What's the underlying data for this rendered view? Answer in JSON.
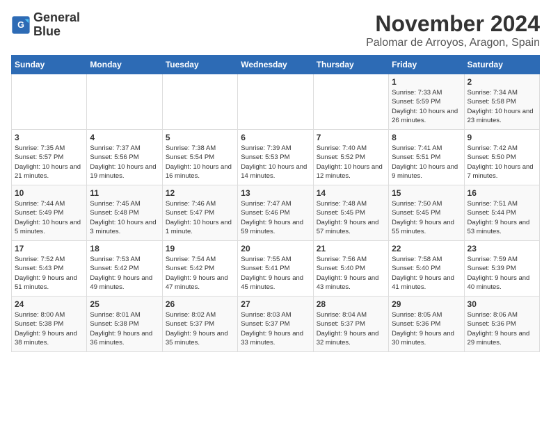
{
  "logo": {
    "line1": "General",
    "line2": "Blue"
  },
  "title": "November 2024",
  "location": "Palomar de Arroyos, Aragon, Spain",
  "days_of_week": [
    "Sunday",
    "Monday",
    "Tuesday",
    "Wednesday",
    "Thursday",
    "Friday",
    "Saturday"
  ],
  "weeks": [
    [
      {
        "day": "",
        "info": ""
      },
      {
        "day": "",
        "info": ""
      },
      {
        "day": "",
        "info": ""
      },
      {
        "day": "",
        "info": ""
      },
      {
        "day": "",
        "info": ""
      },
      {
        "day": "1",
        "info": "Sunrise: 7:33 AM\nSunset: 5:59 PM\nDaylight: 10 hours and 26 minutes."
      },
      {
        "day": "2",
        "info": "Sunrise: 7:34 AM\nSunset: 5:58 PM\nDaylight: 10 hours and 23 minutes."
      }
    ],
    [
      {
        "day": "3",
        "info": "Sunrise: 7:35 AM\nSunset: 5:57 PM\nDaylight: 10 hours and 21 minutes."
      },
      {
        "day": "4",
        "info": "Sunrise: 7:37 AM\nSunset: 5:56 PM\nDaylight: 10 hours and 19 minutes."
      },
      {
        "day": "5",
        "info": "Sunrise: 7:38 AM\nSunset: 5:54 PM\nDaylight: 10 hours and 16 minutes."
      },
      {
        "day": "6",
        "info": "Sunrise: 7:39 AM\nSunset: 5:53 PM\nDaylight: 10 hours and 14 minutes."
      },
      {
        "day": "7",
        "info": "Sunrise: 7:40 AM\nSunset: 5:52 PM\nDaylight: 10 hours and 12 minutes."
      },
      {
        "day": "8",
        "info": "Sunrise: 7:41 AM\nSunset: 5:51 PM\nDaylight: 10 hours and 9 minutes."
      },
      {
        "day": "9",
        "info": "Sunrise: 7:42 AM\nSunset: 5:50 PM\nDaylight: 10 hours and 7 minutes."
      }
    ],
    [
      {
        "day": "10",
        "info": "Sunrise: 7:44 AM\nSunset: 5:49 PM\nDaylight: 10 hours and 5 minutes."
      },
      {
        "day": "11",
        "info": "Sunrise: 7:45 AM\nSunset: 5:48 PM\nDaylight: 10 hours and 3 minutes."
      },
      {
        "day": "12",
        "info": "Sunrise: 7:46 AM\nSunset: 5:47 PM\nDaylight: 10 hours and 1 minute."
      },
      {
        "day": "13",
        "info": "Sunrise: 7:47 AM\nSunset: 5:46 PM\nDaylight: 9 hours and 59 minutes."
      },
      {
        "day": "14",
        "info": "Sunrise: 7:48 AM\nSunset: 5:45 PM\nDaylight: 9 hours and 57 minutes."
      },
      {
        "day": "15",
        "info": "Sunrise: 7:50 AM\nSunset: 5:45 PM\nDaylight: 9 hours and 55 minutes."
      },
      {
        "day": "16",
        "info": "Sunrise: 7:51 AM\nSunset: 5:44 PM\nDaylight: 9 hours and 53 minutes."
      }
    ],
    [
      {
        "day": "17",
        "info": "Sunrise: 7:52 AM\nSunset: 5:43 PM\nDaylight: 9 hours and 51 minutes."
      },
      {
        "day": "18",
        "info": "Sunrise: 7:53 AM\nSunset: 5:42 PM\nDaylight: 9 hours and 49 minutes."
      },
      {
        "day": "19",
        "info": "Sunrise: 7:54 AM\nSunset: 5:42 PM\nDaylight: 9 hours and 47 minutes."
      },
      {
        "day": "20",
        "info": "Sunrise: 7:55 AM\nSunset: 5:41 PM\nDaylight: 9 hours and 45 minutes."
      },
      {
        "day": "21",
        "info": "Sunrise: 7:56 AM\nSunset: 5:40 PM\nDaylight: 9 hours and 43 minutes."
      },
      {
        "day": "22",
        "info": "Sunrise: 7:58 AM\nSunset: 5:40 PM\nDaylight: 9 hours and 41 minutes."
      },
      {
        "day": "23",
        "info": "Sunrise: 7:59 AM\nSunset: 5:39 PM\nDaylight: 9 hours and 40 minutes."
      }
    ],
    [
      {
        "day": "24",
        "info": "Sunrise: 8:00 AM\nSunset: 5:38 PM\nDaylight: 9 hours and 38 minutes."
      },
      {
        "day": "25",
        "info": "Sunrise: 8:01 AM\nSunset: 5:38 PM\nDaylight: 9 hours and 36 minutes."
      },
      {
        "day": "26",
        "info": "Sunrise: 8:02 AM\nSunset: 5:37 PM\nDaylight: 9 hours and 35 minutes."
      },
      {
        "day": "27",
        "info": "Sunrise: 8:03 AM\nSunset: 5:37 PM\nDaylight: 9 hours and 33 minutes."
      },
      {
        "day": "28",
        "info": "Sunrise: 8:04 AM\nSunset: 5:37 PM\nDaylight: 9 hours and 32 minutes."
      },
      {
        "day": "29",
        "info": "Sunrise: 8:05 AM\nSunset: 5:36 PM\nDaylight: 9 hours and 30 minutes."
      },
      {
        "day": "30",
        "info": "Sunrise: 8:06 AM\nSunset: 5:36 PM\nDaylight: 9 hours and 29 minutes."
      }
    ]
  ]
}
